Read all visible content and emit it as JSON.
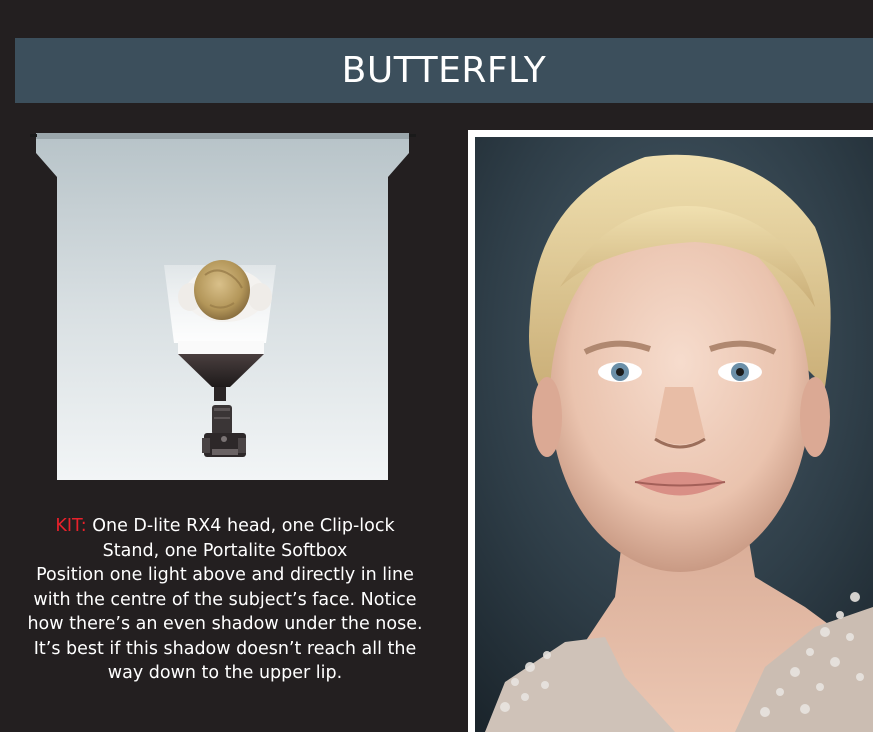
{
  "title": "BUTTERFLY",
  "caption": {
    "kit_label": "KIT:",
    "kit_line_1": " One D-lite RX4 head, one Clip-lock",
    "kit_line_2": "Stand, one Portalite Softbox",
    "body_lines": [
      "Position one light above and directly in line",
      "with the centre of the subject’s face. Notice",
      "how there’s an even shadow under the nose.",
      "It’s best if this shadow doesn’t reach all the",
      "way down to the upper lip."
    ]
  },
  "colors": {
    "background": "#231f20",
    "title_bar": "#3c4f5c",
    "kit_label": "#e8212b",
    "frame": "#ffffff"
  },
  "icons": {
    "backdrop": "studio-backdrop-icon",
    "subject": "subject-head-icon",
    "softbox": "softbox-icon",
    "camera": "camera-icon"
  }
}
